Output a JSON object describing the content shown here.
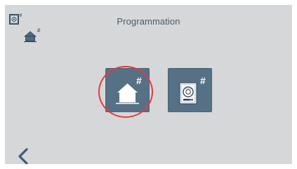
{
  "header": {
    "title": "Programmation"
  },
  "status_icons": [
    {
      "icon": "intercom-settings-icon",
      "badge": "#"
    },
    {
      "icon": "home-settings-icon",
      "badge": "#"
    }
  ],
  "tiles": [
    {
      "icon": "home-icon",
      "badge": "#",
      "highlighted": true
    },
    {
      "icon": "intercom-unit-icon",
      "badge": "#",
      "highlighted": false
    }
  ],
  "navigation": {
    "back_icon": "chevron-left-icon"
  },
  "colors": {
    "background": "#d6d7d9",
    "tile": "#567186",
    "title_text": "#4b5a68",
    "highlight": "#e03d3a",
    "back_arrow": "#3f5c77"
  }
}
